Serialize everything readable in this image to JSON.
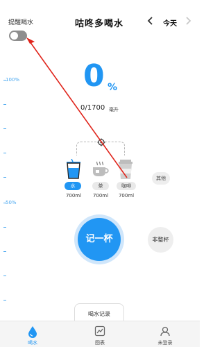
{
  "header": {
    "reminder_label": "提醒喝水",
    "title": "咕咚多喝水",
    "prev_icon": "chevron-left-icon",
    "day_label": "今天",
    "next_icon": "chevron-right-icon"
  },
  "scale": {
    "top_label": "100%",
    "mid_label": "50%"
  },
  "progress": {
    "percent": "0",
    "percent_sign": "%",
    "amount": "0/1700",
    "unit": "毫升"
  },
  "drinks": [
    {
      "label": "水",
      "volume": "700ml",
      "icon": "water-cup-icon",
      "selected": true
    },
    {
      "label": "茶",
      "volume": "700ml",
      "icon": "tea-cup-icon",
      "selected": false
    },
    {
      "label": "咖啡",
      "volume": "700ml",
      "icon": "coffee-cup-icon",
      "selected": false
    }
  ],
  "other_label": "其他",
  "record_label": "记一杯",
  "partial_label": "非整杯",
  "history_label": "喝水记录",
  "nav": [
    {
      "label": "喝水",
      "icon": "water-drop-icon"
    },
    {
      "label": "图表",
      "icon": "chart-icon"
    },
    {
      "label": "未登录",
      "icon": "user-icon"
    }
  ],
  "colors": {
    "accent": "#2196f3",
    "toggle_off": "#8e8e8e"
  }
}
